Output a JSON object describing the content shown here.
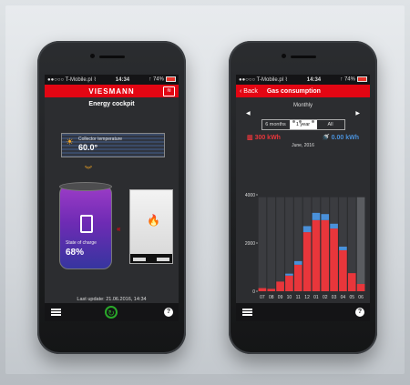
{
  "status_bar": {
    "carrier": "●●○○○ T-Mobile.pl ⌇",
    "time": "14:34",
    "battery": "↑ 74%"
  },
  "left": {
    "brand": "VIESMANN",
    "title": "Energy cockpit",
    "collector_label": "Collector temperature",
    "collector_value": "60.0°",
    "soc_label": "State of charge",
    "soc_value": "68%",
    "last_update": "Last update: 21.06.2016, 14:34"
  },
  "right": {
    "back_label": "Back",
    "nav_title": "Gas consumption",
    "period_label": "Monthly",
    "tabs": [
      "6 months",
      "1 year",
      "All"
    ],
    "selected_tab": "1 year",
    "gas_value": "300 kWh",
    "dhw_value": "0.00 kWh",
    "current_period": "June, 2016",
    "gas_color": "#e8363b",
    "dhw_color": "#4a90d9"
  },
  "chart_data": {
    "type": "bar",
    "title": "",
    "categories": [
      "07",
      "08",
      "09",
      "10",
      "11",
      "12",
      "01",
      "02",
      "03",
      "04",
      "05",
      "06"
    ],
    "series": [
      {
        "values": [
          130,
          100,
          400,
          650,
          1100,
          2450,
          2950,
          2950,
          2600,
          1700,
          750,
          300
        ]
      },
      {
        "values": [
          0,
          0,
          0,
          80,
          150,
          250,
          300,
          250,
          200,
          150,
          0,
          0
        ]
      }
    ],
    "max_bars": [
      3900,
      3900,
      3900,
      3900,
      3900,
      3900,
      3900,
      3900,
      3900,
      3900,
      3900,
      3900
    ],
    "yticks": [
      "0",
      "2000",
      "4000"
    ],
    "ylim": [
      0,
      4000
    ],
    "grid": false
  }
}
